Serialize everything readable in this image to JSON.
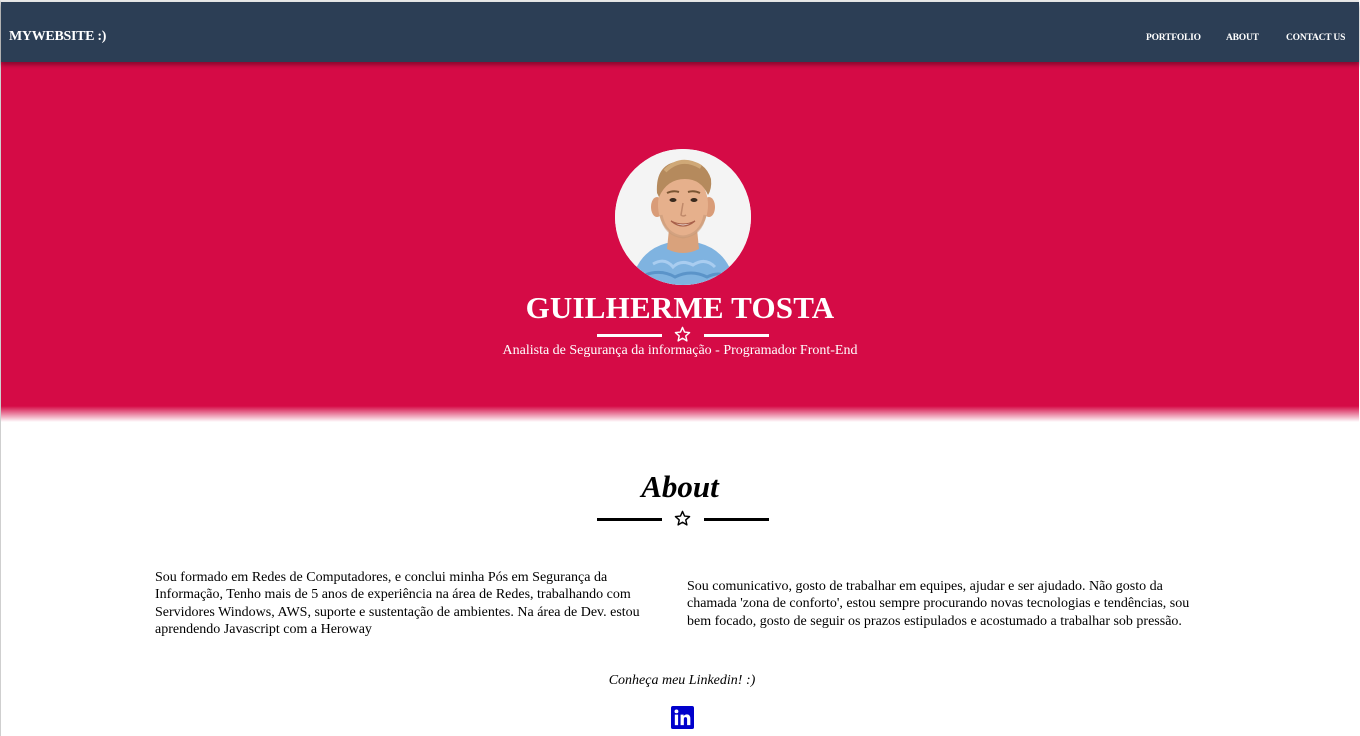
{
  "navbar": {
    "brand": "MYWEBSITE :)",
    "links": [
      {
        "label": "PORTFOLIO"
      },
      {
        "label": "ABOUT"
      },
      {
        "label": "CONTACT US"
      }
    ]
  },
  "hero": {
    "name": "GUILHERME TOSTA",
    "subtitle": "Analista de Segurança da informação - Programador Front-End",
    "avatar_alt": "Profile photo"
  },
  "about": {
    "title": "About",
    "left_text": "Sou formado em Redes de Computadores, e conclui minha Pós em Segurança da Informação, Tenho mais de 5 anos de experiência na área de Redes, trabalhando com Servidores Windows, AWS, suporte e sustentação de ambientes. Na área de Dev. estou aprendendo Javascript com a Heroway",
    "right_text": "Sou comunicativo, gosto de trabalhar em equipes, ajudar e ser ajudado. Não gosto da chamada 'zona de conforto', estou sempre procurando novas tecnologias e tendências, sou bem focado, gosto de seguir os prazos estipulados e acostumado a trabalhar sob pressão.",
    "linkedin_caption": "Conheça meu Linkedin! :)"
  },
  "colors": {
    "navbar": "#2c3e55",
    "hero": "#d50b46",
    "linkedin": "#0000cc"
  },
  "icons": {
    "hero_divider": "star-icon",
    "about_divider": "star-icon",
    "linkedin": "linkedin-icon"
  }
}
